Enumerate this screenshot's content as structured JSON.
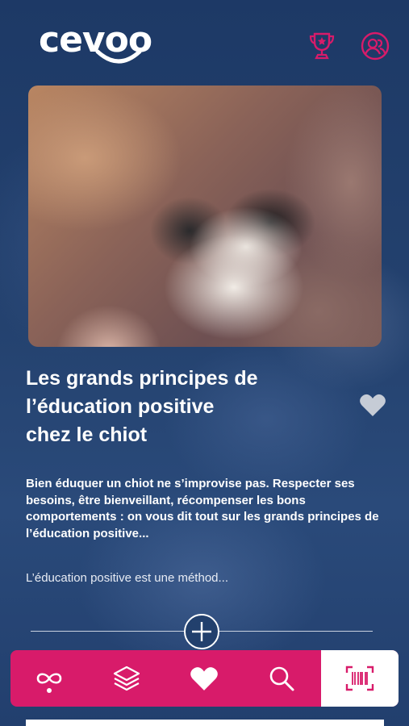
{
  "header": {
    "logo_text": "cevoo",
    "icons": [
      "trophy-icon",
      "profile-icon"
    ]
  },
  "article": {
    "image_alt": "Chiot endormi dans les bras",
    "title_lines": [
      "Les grands principes de",
      "l’éducation positive",
      "chez le chiot"
    ],
    "lead": "Bien éduquer un chiot ne s’improvise pas. Respecter ses besoins, être bienveillant, récompenser les bons comportements : on vous dit tout sur les grands principes de l’éducation positive...",
    "excerpt": "L’éducation positive est une méthod..."
  },
  "tabbar": {
    "tabs": [
      {
        "icon": "infinity-icon",
        "active": false,
        "indicator": true
      },
      {
        "icon": "layers-icon",
        "active": false
      },
      {
        "icon": "heart-icon",
        "active": false
      },
      {
        "icon": "search-icon",
        "active": false
      },
      {
        "icon": "barcode-scan-icon",
        "active": true
      }
    ]
  },
  "colors": {
    "background": "#1e3a66",
    "accent": "#d81b6a",
    "text": "#ffffff"
  }
}
